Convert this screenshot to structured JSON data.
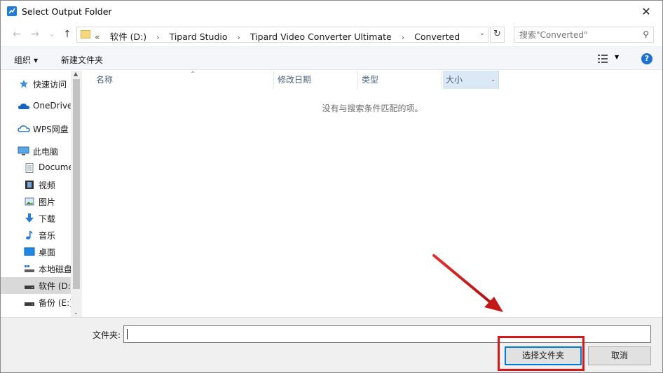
{
  "window": {
    "title": "Select Output Folder",
    "close_glyph": "✕"
  },
  "nav": {
    "back_glyph": "←",
    "forward_glyph": "→",
    "recent_glyph": "⌄",
    "up_glyph": "↑"
  },
  "address": {
    "overflow": "«",
    "crumbs": [
      "软件 (D:)",
      "Tipard Studio",
      "Tipard Video Converter Ultimate",
      "Converted"
    ],
    "separator": "›",
    "dropdown_glyph": "⌄",
    "refresh_glyph": "↻"
  },
  "search": {
    "placeholder": "搜索\"Converted\"",
    "icon": "search-icon",
    "glyph": "⚲"
  },
  "toolbar": {
    "organize_label": "组织",
    "organize_caret": "▼",
    "new_folder_label": "新建文件夹",
    "view_caret": "▼",
    "help_glyph": "?"
  },
  "sidebar": {
    "items": [
      {
        "label": "快速访问",
        "icon": "star-icon"
      },
      {
        "label": "OneDrive",
        "icon": "cloud-icon"
      },
      {
        "label": "WPS网盘",
        "icon": "wps-cloud-icon"
      },
      {
        "label": "此电脑",
        "icon": "computer-icon"
      },
      {
        "label": "Docume",
        "icon": "documents-icon"
      },
      {
        "label": "视频",
        "icon": "video-icon"
      },
      {
        "label": "图片",
        "icon": "pictures-icon"
      },
      {
        "label": "下载",
        "icon": "download-icon"
      },
      {
        "label": "音乐",
        "icon": "music-icon"
      },
      {
        "label": "桌面",
        "icon": "desktop-icon"
      },
      {
        "label": "本地磁盘",
        "icon": "drive-icon"
      },
      {
        "label": "软件 (D:",
        "icon": "drive-icon",
        "selected": true
      },
      {
        "label": "备份 (E:)",
        "icon": "drive-icon"
      }
    ],
    "scroll_up": "▲",
    "scroll_down": "⌄"
  },
  "filelist": {
    "columns": [
      "名称",
      "修改日期",
      "类型",
      "大小"
    ],
    "sort_caret": "⌃",
    "size_drop": "⌄",
    "empty_message": "没有与搜索条件匹配的项。"
  },
  "bottom": {
    "folder_label": "文件夹:",
    "folder_value": "",
    "select_button": "选择文件夹",
    "cancel_button": "取消"
  },
  "colors": {
    "accent": "#0078d7",
    "highlight_red": "#d3191a"
  }
}
